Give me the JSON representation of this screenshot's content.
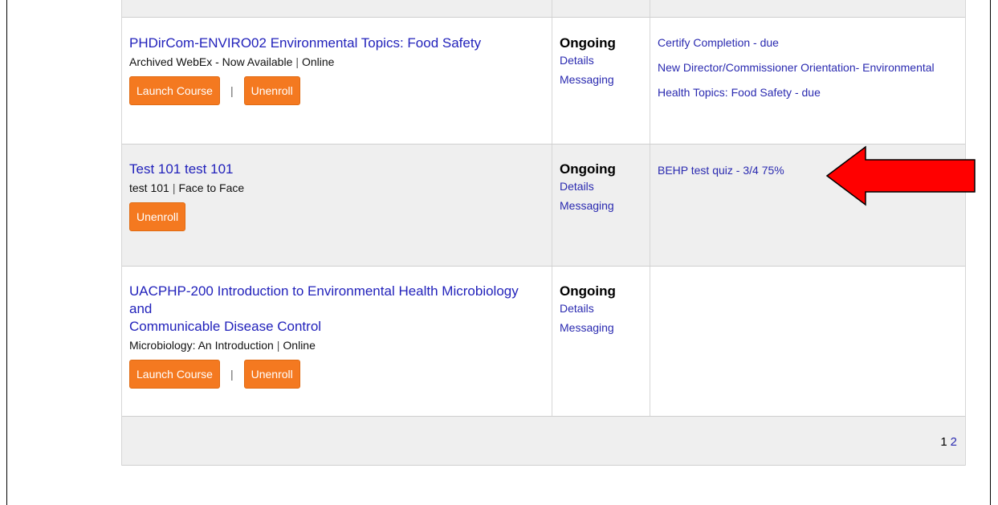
{
  "courses": [
    {
      "title": "PHDirCom-ENVIRO02 Environmental Topics: Food Safety",
      "meta_name": "Archived WebEx - Now Available",
      "meta_type": "Online",
      "launch_label": "Launch Course",
      "unenroll_label": "Unenroll",
      "status": "Ongoing",
      "details_label": "Details",
      "messaging_label": "Messaging",
      "requirements": [
        "Certify Completion - due",
        "New Director/Commissioner Orientation- Environmental",
        "Health Topics: Food Safety - due"
      ]
    },
    {
      "title": "Test 101 test 101",
      "meta_name": "test 101",
      "meta_type": "Face to Face",
      "unenroll_label": "Unenroll",
      "status": "Ongoing",
      "details_label": "Details",
      "messaging_label": "Messaging",
      "requirements": [
        "BEHP test quiz - 3/4 75%"
      ]
    },
    {
      "title_line1": "UACPHP-200 Introduction to Environmental Health Microbiology and",
      "title_line2": "Communicable Disease Control",
      "meta_name": "Microbiology: An Introduction",
      "meta_type": "Online",
      "launch_label": "Launch Course",
      "unenroll_label": "Unenroll",
      "status": "Ongoing",
      "details_label": "Details",
      "messaging_label": "Messaging"
    }
  ],
  "pagination": {
    "current": "1",
    "next": "2"
  },
  "colors": {
    "button": "#f47920",
    "link": "#2a2ab0",
    "arrow": "#ff0000",
    "row_alt": "#efefef"
  },
  "separator": "|"
}
